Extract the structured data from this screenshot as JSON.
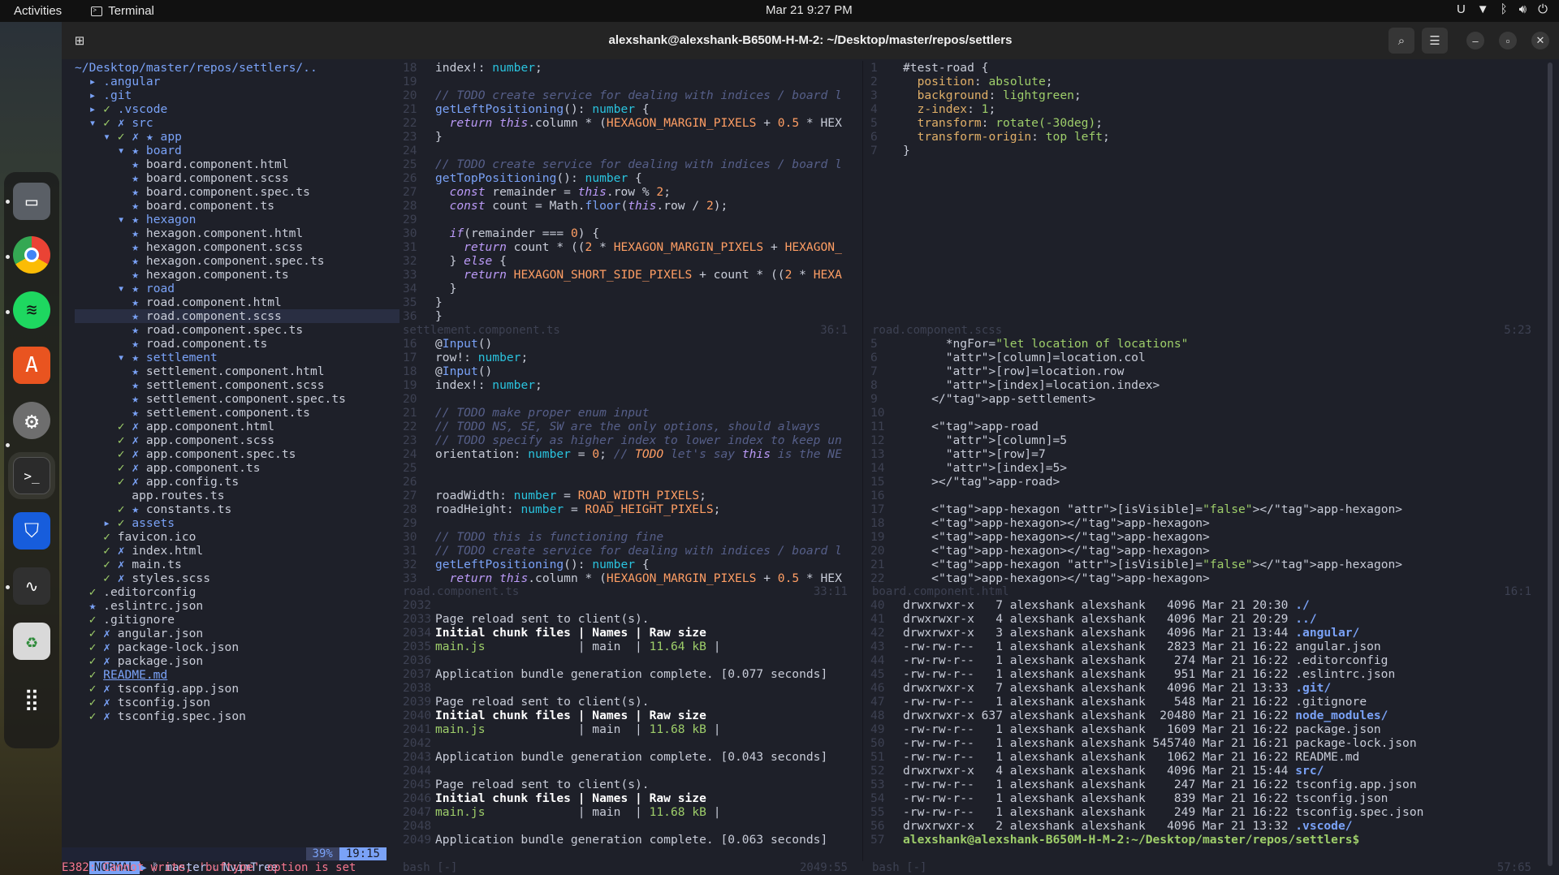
{
  "topbar": {
    "activities": "Activities",
    "app": "Terminal",
    "clock": "Mar 21  9:27 PM"
  },
  "window": {
    "title": "alexshank@alexshank-B650M-H-M-2: ~/Desktop/master/repos/settlers"
  },
  "dock": [
    "files-icon",
    "chrome-icon",
    "spotify-icon",
    "app-center-icon",
    "settings-icon",
    "terminal-icon",
    "bitwarden-icon",
    "system-monitor-icon",
    "trash-icon",
    "app-grid-icon"
  ],
  "tree": {
    "lines": [
      "~/Desktop/master/repos/settlers/..",
      "  ▸ .angular",
      "  ▸ .git",
      "  ▸ ✓ .vscode",
      "  ▾ ✓ ✗ src",
      "    ▾ ✓ ✗ ★ app",
      "      ▾ ★ board",
      "        ★ board.component.html",
      "        ★ board.component.scss",
      "        ★ board.component.spec.ts",
      "        ★ board.component.ts",
      "      ▾ ★ hexagon",
      "        ★ hexagon.component.html",
      "        ★ hexagon.component.scss",
      "        ★ hexagon.component.spec.ts",
      "        ★ hexagon.component.ts",
      "      ▾ ★ road",
      "        ★ road.component.html",
      "        ★ road.component.scss",
      "        ★ road.component.spec.ts",
      "        ★ road.component.ts",
      "      ▾ ★ settlement",
      "        ★ settlement.component.html",
      "        ★ settlement.component.scss",
      "        ★ settlement.component.spec.ts",
      "        ★ settlement.component.ts",
      "      ✓ ✗ app.component.html",
      "      ✓ ✗ app.component.scss",
      "      ✓ ✗ app.component.spec.ts",
      "      ✓ ✗ app.component.ts",
      "      ✓ ✗ app.config.ts",
      "        app.routes.ts",
      "      ✓ ★ constants.ts",
      "    ▸ ✓ assets",
      "    ✓ favicon.ico",
      "    ✓ ✗ index.html",
      "    ✓ ✗ main.ts",
      "    ✓ ✗ styles.scss",
      "  ✓ .editorconfig",
      "  ★ .eslintrc.json",
      "  ✓ .gitignore",
      "  ✓ ✗ angular.json",
      "  ✓ ✗ package-lock.json",
      "  ✓ ✗ package.json",
      "  ✓ README.md",
      "  ✓ ✗ tsconfig.app.json",
      "  ✓ ✗ tsconfig.json",
      "  ✓ ✗ tsconfig.spec.json"
    ]
  },
  "pane1": {
    "start": 18,
    "lines": [
      "index!: number;",
      "",
      "// TODO create service for dealing with indices / board l",
      "getLeftPositioning(): number {",
      "  return this.column * (HEXAGON_MARGIN_PIXELS + 0.5 * HEX",
      "}",
      "",
      "// TODO create service for dealing with indices / board l",
      "getTopPositioning(): number {",
      "  const remainder = this.row % 2;",
      "  const count = Math.floor(this.row / 2);",
      "",
      "  if(remainder === 0) {",
      "    return count * ((2 * HEXAGON_MARGIN_PIXELS + HEXAGON_",
      "  } else {",
      "    return HEXAGON_SHORT_SIDE_PIXELS + count * ((2 * HEXA",
      "  }",
      "}",
      "}"
    ],
    "status": "settlement.component.ts",
    "pos": "36:1"
  },
  "pane2": {
    "start": 1,
    "lines": [
      "#test-road {",
      "  position: absolute;",
      "  background: lightgreen;",
      "  z-index: 1;",
      "  transform: rotate(-30deg);",
      "  transform-origin: top left;",
      "}"
    ],
    "status": "road.component.scss",
    "pos": "5:23"
  },
  "pane3": {
    "start": 16,
    "lines": [
      "@Input()",
      "row!: number;",
      "@Input()",
      "index!: number;",
      "",
      "// TODO make proper enum input",
      "// TODO NS, SE, SW are the only options, should always",
      "// TODO specify as higher index to lower index to keep un",
      "orientation: number = 0; // TODO let's say this is the NE",
      "",
      "",
      "roadWidth: number = ROAD_WIDTH_PIXELS;",
      "roadHeight: number = ROAD_HEIGHT_PIXELS;",
      "",
      "// TODO this is functioning fine",
      "// TODO create service for dealing with indices / board l",
      "getLeftPositioning(): number {",
      "  return this.column * (HEXAGON_MARGIN_PIXELS + 0.5 * HEX"
    ],
    "status": "road.component.ts",
    "pos": "33:11"
  },
  "pane4": {
    "start": 5,
    "lines": [
      "      *ngFor=\"let location of locations\"",
      "      [column]=location.col",
      "      [row]=location.row",
      "      [index]=location.index>",
      "    </app-settlement>",
      "",
      "    <app-road",
      "      [column]=5",
      "      [row]=7",
      "      [index]=5>",
      "    ></app-road>",
      "",
      "    <app-hexagon [isVisible]=\"false\"></app-hexagon>",
      "    <app-hexagon></app-hexagon>",
      "    <app-hexagon></app-hexagon>",
      "    <app-hexagon></app-hexagon>",
      "    <app-hexagon [isVisible]=\"false\"></app-hexagon>",
      "    <app-hexagon></app-hexagon>"
    ],
    "status": "board.component.html",
    "pos": "16:1"
  },
  "term1": {
    "start": 2032,
    "lines": [
      "",
      "Page reload sent to client(s).",
      "Initial chunk files | Names | Raw size",
      "main.js             | main  | 11.64 kB |",
      "",
      "Application bundle generation complete. [0.077 seconds]",
      "",
      "Page reload sent to client(s).",
      "Initial chunk files | Names | Raw size",
      "main.js             | main  | 11.68 kB |",
      "",
      "Application bundle generation complete. [0.043 seconds]",
      "",
      "Page reload sent to client(s).",
      "Initial chunk files | Names | Raw size",
      "main.js             | main  | 11.68 kB |",
      "",
      "Application bundle generation complete. [0.063 seconds]"
    ],
    "status": "bash [-]",
    "pos": "2049:55"
  },
  "term2": {
    "start": 40,
    "lines": [
      "drwxrwxr-x   7 alexshank alexshank   4096 Mar 21 20:30 ./",
      "drwxrwxr-x   4 alexshank alexshank   4096 Mar 21 20:29 ../",
      "drwxrwxr-x   3 alexshank alexshank   4096 Mar 21 13:44 .angular/",
      "-rw-rw-r--   1 alexshank alexshank   2823 Mar 21 16:22 angular.json",
      "-rw-rw-r--   1 alexshank alexshank    274 Mar 21 16:22 .editorconfig",
      "-rw-rw-r--   1 alexshank alexshank    951 Mar 21 16:22 .eslintrc.json",
      "drwxrwxr-x   7 alexshank alexshank   4096 Mar 21 13:33 .git/",
      "-rw-rw-r--   1 alexshank alexshank    548 Mar 21 16:22 .gitignore",
      "drwxrwxr-x 637 alexshank alexshank  20480 Mar 21 16:22 node_modules/",
      "-rw-rw-r--   1 alexshank alexshank   1609 Mar 21 16:22 package.json",
      "-rw-rw-r--   1 alexshank alexshank 545740 Mar 21 16:21 package-lock.json",
      "-rw-rw-r--   1 alexshank alexshank   1062 Mar 21 16:22 README.md",
      "drwxrwxr-x   4 alexshank alexshank   4096 Mar 21 15:44 src/",
      "-rw-rw-r--   1 alexshank alexshank    247 Mar 21 16:22 tsconfig.app.json",
      "-rw-rw-r--   1 alexshank alexshank    839 Mar 21 16:22 tsconfig.json",
      "-rw-rw-r--   1 alexshank alexshank    249 Mar 21 16:22 tsconfig.spec.json",
      "drwxrwxr-x   2 alexshank alexshank   4096 Mar 21 13:32 .vscode/",
      "alexshank@alexshank-B650M-H-M-2:~/Desktop/master/repos/settlers$"
    ],
    "status": "bash [-]",
    "pos": "57:65"
  },
  "statusline": {
    "mode": "NORMAL",
    "branch": "ᚠ master",
    "buffer": "NvimTree",
    "percent": "39%",
    "pos": "19:15"
  },
  "error": "E382: Cannot write, 'buftype' option is set",
  "colors": {
    "mode_bg": "#7aa2f7",
    "status_bg": "#1f2335",
    "accent": "#7aa2f7",
    "error": "#f7768e"
  }
}
